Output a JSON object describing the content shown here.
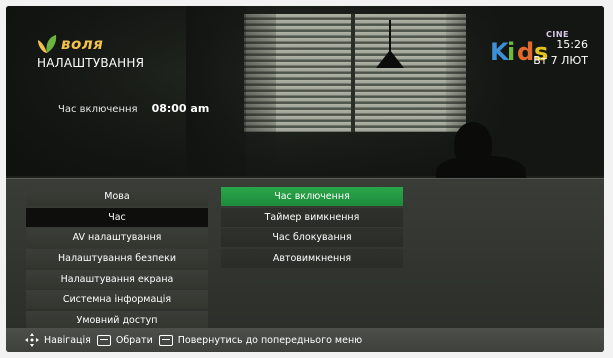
{
  "header": {
    "logo_text": "воля",
    "page_title": "НАЛАШТУВАННЯ",
    "current_setting": {
      "label": "Час включення",
      "value": "08:00 am"
    }
  },
  "channel": {
    "logo_letters": [
      "K",
      "i",
      "d",
      "s"
    ],
    "logo_suffix": "CINE"
  },
  "clock": {
    "time": "15:26",
    "date": "Вт 7 ЛЮТ"
  },
  "menu": {
    "left_items": [
      {
        "label": "Мова",
        "state": "normal"
      },
      {
        "label": "Час",
        "state": "selected"
      },
      {
        "label": "AV налаштування",
        "state": "normal"
      },
      {
        "label": "Налаштування безпеки",
        "state": "normal"
      },
      {
        "label": "Налаштування екрана",
        "state": "normal"
      },
      {
        "label": "Системна інформація",
        "state": "normal"
      },
      {
        "label": "Умовний доступ",
        "state": "normal"
      }
    ],
    "right_items": [
      {
        "label": "Час включення",
        "state": "active"
      },
      {
        "label": "Таймер вимкнення",
        "state": "normal"
      },
      {
        "label": "Час блокування",
        "state": "normal"
      },
      {
        "label": "Автовимкнення",
        "state": "normal"
      }
    ]
  },
  "footer": {
    "nav_icon": "dpad-arrows-icon",
    "navigate_label": "Навігація",
    "ok_icon": "ok-key-icon",
    "select_label": "Обрати",
    "back_icon": "back-key-icon",
    "back_label": "Повернутись до попереднього меню"
  },
  "colors": {
    "accent_green": "#22993f",
    "logo_yellow": "#f2c14e"
  }
}
